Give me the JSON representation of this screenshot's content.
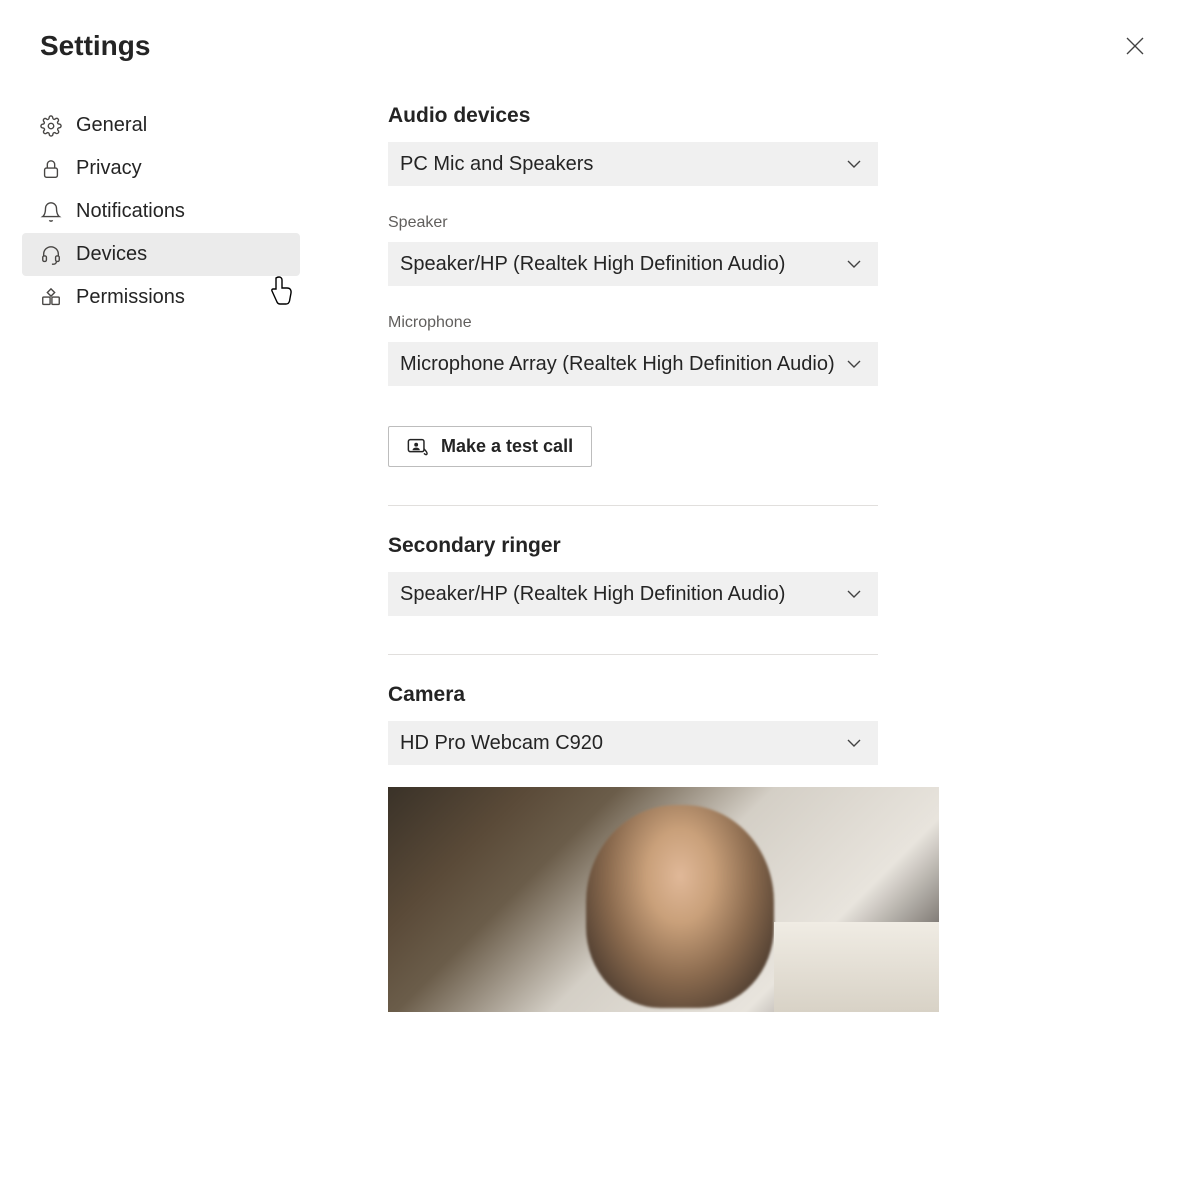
{
  "header": {
    "title": "Settings"
  },
  "sidebar": {
    "items": [
      {
        "label": "General"
      },
      {
        "label": "Privacy"
      },
      {
        "label": "Notifications"
      },
      {
        "label": "Devices"
      },
      {
        "label": "Permissions"
      }
    ]
  },
  "audio": {
    "section_title": "Audio devices",
    "device_value": "PC Mic and Speakers",
    "speaker_label": "Speaker",
    "speaker_value": "Speaker/HP (Realtek High Definition Audio)",
    "microphone_label": "Microphone",
    "microphone_value": "Microphone Array (Realtek High Definition Audio)",
    "test_call_label": "Make a test call"
  },
  "secondary_ringer": {
    "section_title": "Secondary ringer",
    "value": "Speaker/HP (Realtek High Definition Audio)"
  },
  "camera": {
    "section_title": "Camera",
    "value": "HD Pro Webcam C920"
  }
}
